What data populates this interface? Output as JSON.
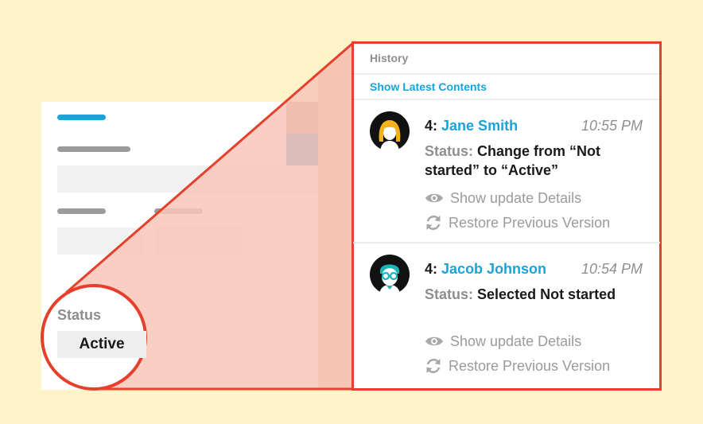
{
  "colors": {
    "background": "#fdf3c8",
    "accent": "#1aa3d9",
    "highlight_border": "#e4402c",
    "zoom_fill": "#f8c6b8",
    "panel_fill": "#f6b894"
  },
  "form": {
    "status_label": "Status",
    "status_value": "Active"
  },
  "history": {
    "header": "History",
    "show_latest_label": "Show Latest Contents",
    "entries": [
      {
        "number": "4:",
        "user": "Jane Smith",
        "time": "10:55 PM",
        "status_key": "Status:",
        "status_text": "Change from “Not started” to “Active”",
        "details_label": "Show update Details",
        "restore_label": "Restore Previous Version",
        "avatar_icon": "female-avatar-icon"
      },
      {
        "number": "4:",
        "user": "Jacob Johnson",
        "time": "10:54 PM",
        "status_key": "Status:",
        "status_text": "Selected Not started",
        "details_label": "Show update Details",
        "restore_label": "Restore Previous Version",
        "avatar_icon": "male-avatar-icon"
      }
    ]
  }
}
